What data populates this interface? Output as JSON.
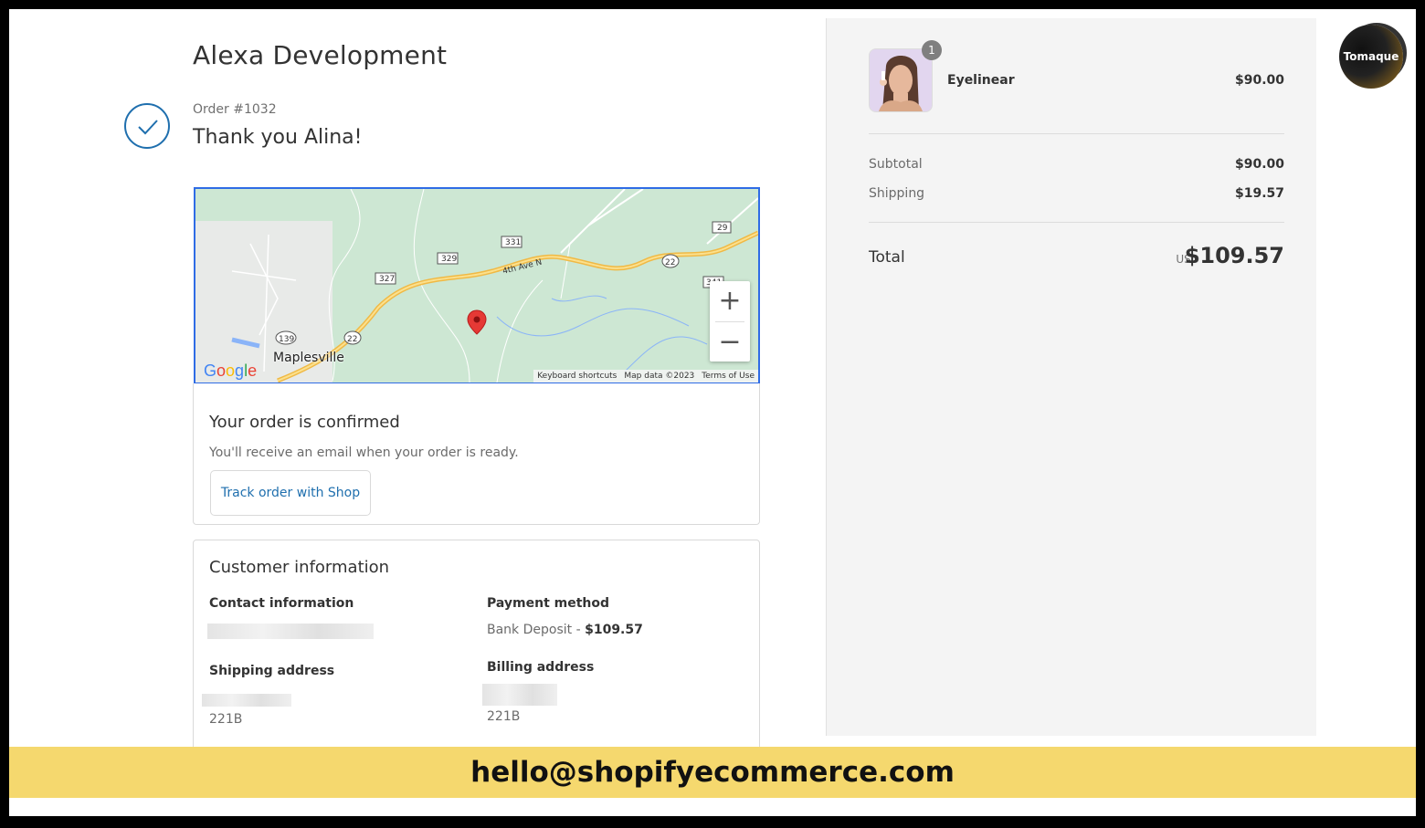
{
  "store": {
    "title": "Alexa Development"
  },
  "order": {
    "number": "Order #1032",
    "greeting": "Thank you Alina!"
  },
  "map": {
    "town": "Maplesville",
    "road_label": "4th Ave N",
    "route_shields": [
      "22",
      "139",
      "327",
      "329",
      "331",
      "29",
      "341"
    ],
    "google_logo": [
      "G",
      "o",
      "o",
      "g",
      "l",
      "e"
    ],
    "footer": [
      "Keyboard shortcuts",
      "Map data ©2023",
      "Terms of Use"
    ],
    "zoom_in": "+",
    "zoom_out": "−"
  },
  "confirmation": {
    "heading": "Your order is confirmed",
    "message": "You'll receive an email when your order is ready.",
    "track_button": "Track order with Shop"
  },
  "customer": {
    "heading": "Customer information",
    "contact_label": "Contact information",
    "payment_label": "Payment method",
    "payment_method": "Bank Deposit",
    "payment_sep": " - ",
    "payment_amount": "$109.57",
    "shipping_label": "Shipping address",
    "shipping_line": "221B",
    "billing_label": "Billing address",
    "billing_line": "221B"
  },
  "summary": {
    "item": {
      "name": "Eyelinear",
      "price": "$90.00",
      "quantity": "1"
    },
    "subtotal_label": "Subtotal",
    "subtotal_value": "$90.00",
    "shipping_label": "Shipping",
    "shipping_value": "$19.57",
    "total_label": "Total",
    "total_currency": "USD",
    "total_value": "$109.57"
  },
  "brand_badge": "Tomaque",
  "banner": {
    "email": "hello@shopifyecommerce.com"
  },
  "colors": {
    "accent": "#1f6fae",
    "map_border": "#2f6ce5",
    "banner": "#f5d86e",
    "pin": "#e53935"
  }
}
